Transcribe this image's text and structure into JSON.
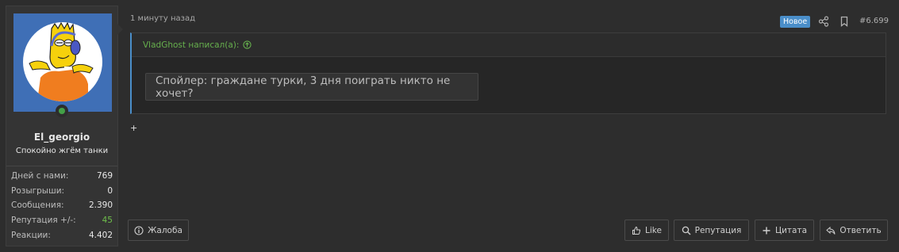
{
  "user": {
    "name": "El_georgio",
    "title": "Спокойно жгём танки",
    "stats": [
      {
        "label": "Дней с нами:",
        "value": "769"
      },
      {
        "label": "Розыгрыши:",
        "value": "0"
      },
      {
        "label": "Сообщения:",
        "value": "2.390"
      },
      {
        "label": "Репутация +/-:",
        "value": "45"
      },
      {
        "label": "Реакции:",
        "value": "4.402"
      }
    ]
  },
  "post": {
    "timestamp": "1 минуту назад",
    "badge": "Новое",
    "number": "#6.699",
    "quote_author": "VladGhost написал(а):",
    "spoiler": "Спойлер: граждане турки, 3 дня поиграть никто не хочет?",
    "body": "+"
  },
  "actions": {
    "report": "Жалоба",
    "like": "Like",
    "reputation": "Репутация",
    "quote": "Цитата",
    "reply": "Ответить"
  },
  "colors": {
    "accent": "#4a8ec9",
    "quote_author": "#66b04d",
    "reputation_positive": "#6fbf4b",
    "online": "#43a047"
  },
  "icons": [
    "share-icon",
    "bookmark-icon",
    "arrow-up-circle-icon",
    "info-icon",
    "thumbs-up-icon",
    "search-icon",
    "plus-icon",
    "reply-icon"
  ]
}
